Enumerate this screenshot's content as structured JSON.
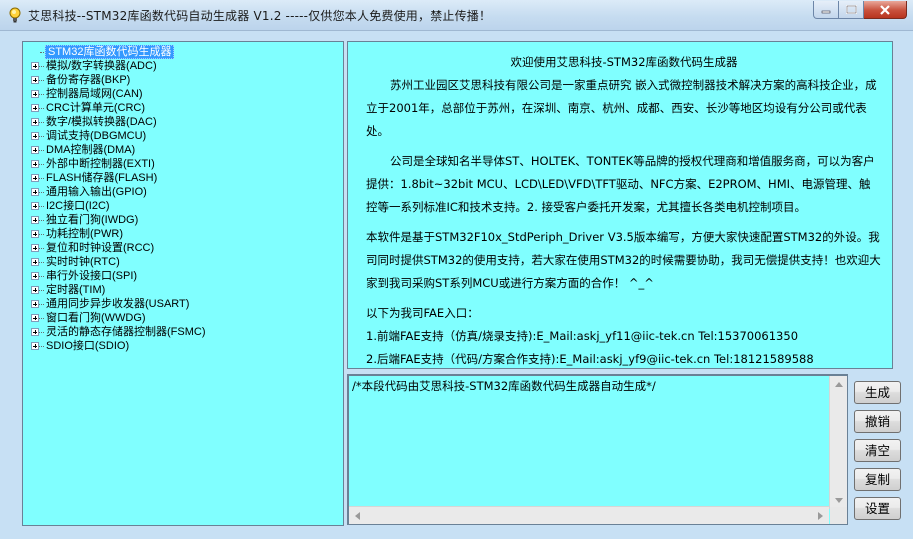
{
  "window": {
    "title": "艾思科技--STM32库函数代码自动生成器 V1.2 -----仅供您本人免费使用，禁止传播！",
    "controls": [
      "minimize",
      "maximize",
      "close"
    ]
  },
  "tree": {
    "root": "STM32库函数代码生成器",
    "items": [
      "模拟/数字转换器(ADC)",
      "备份寄存器(BKP)",
      "控制器局域网(CAN)",
      "CRC计算单元(CRC)",
      "数字/模拟转换器(DAC)",
      "调试支持(DBGMCU)",
      "DMA控制器(DMA)",
      "外部中断控制器(EXTI)",
      "FLASH储存器(FLASH)",
      "通用输入输出(GPIO)",
      "I2C接口(I2C)",
      "独立看门狗(IWDG)",
      "功耗控制(PWR)",
      "复位和时钟设置(RCC)",
      "实时时钟(RTC)",
      "串行外设接口(SPI)",
      "定时器(TIM)",
      "通用同步异步收发器(USART)",
      "窗口看门狗(WWDG)",
      "灵活的静态存储器控制器(FSMC)",
      "SDIO接口(SDIO)"
    ]
  },
  "info": {
    "welcome": "欢迎使用艾思科技-STM32库函数代码生成器",
    "p1": "苏州工业园区艾思科技有限公司是一家重点研究 嵌入式微控制器技术解决方案的高科技企业，成立于2001年，总部位于苏州，在深圳、南京、杭州、成都、西安、长沙等地区均设有分公司或代表处。",
    "p2": "公司是全球知名半导体ST、HOLTEK、TONTEK等品牌的授权代理商和增值服务商，可以为客户提供：1.8bit~32bit MCU、LCD\\LED\\VFD\\TFT驱动、NFC方案、E2PROM、HMI、电源管理、触控等一系列标准IC和技术支持。2. 接受客户委托开发案，尤其擅长各类电机控制项目。",
    "p3": "本软件是基于STM32F10x_StdPeriph_Driver V3.5版本编写，方便大家快速配置STM32的外设。我司同时提供STM32的使用支持，若大家在使用STM32的时候需要协助，我司无偿提供支持！也欢迎大家到我司采购ST系列MCU或进行方案方面的合作！ ^_^",
    "fae_heading": "以下为我司FAE入口：",
    "fae1": "1.前端FAE支持（仿真/烧录支持):E_Mail:askj_yf11@iic-tek.cn Tel:15370061350",
    "fae2": "2.后端FAE支持（代码/方案合作支持):E_Mail:askj_yf9@iic-tek.cn Tel:18121589588"
  },
  "code": {
    "text": "/*本段代码由艾思科技-STM32库函数代码生成器自动生成*/"
  },
  "buttons": {
    "generate": "生成",
    "undo": "撤销",
    "clear": "清空",
    "copy": "复制",
    "settings": "设置"
  },
  "colors": {
    "panel_bg": "#80ffff",
    "window_bg": "#c7e0f4",
    "selection": "#3399ff"
  }
}
